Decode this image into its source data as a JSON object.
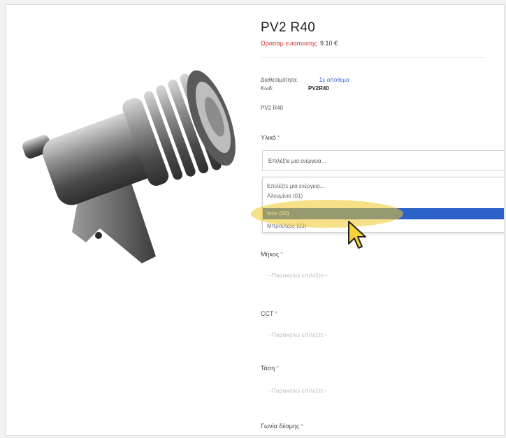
{
  "product": {
    "title": "PV2 R40",
    "price_label": "Ωρασαμ ευιαιτυιιοης",
    "price_value": "9.10 €",
    "availability_label": "Διαθεσιμότητα:",
    "availability_value": "Σε απόθεμα",
    "code_label": "Κωδ:",
    "code_value": "PV2R40",
    "sku_text": "PV2 R40"
  },
  "form": {
    "material": {
      "label": "Υλικό",
      "required_mark": "*",
      "placeholder": "Επιλέξτε μια ενέργεια...",
      "options": [
        "Επιλέξτε μια ενέργεια...",
        "Αλουμίνιο (01)",
        "Inox (03)",
        "Μπρούτζος (03)"
      ],
      "selected_index": 2
    },
    "length": {
      "label": "Μήκος",
      "required_mark": "*",
      "placeholder": "--Παρακαλώ επιλέξτε--"
    },
    "cct": {
      "label": "CCT",
      "required_mark": "*",
      "placeholder": "--Παρακαλώ επιλέξτε--"
    },
    "voltage": {
      "label": "Τάση",
      "required_mark": "*",
      "placeholder": "--Παρακαλώ επιλέξτε--"
    },
    "beam_angle": {
      "label": "Γωνία δέσμης",
      "required_mark": "*"
    }
  },
  "icons": {
    "cursor": "pointer-arrow-icon",
    "product_image": "spotlight-product-image"
  },
  "colors": {
    "highlight": "#eec828",
    "selected_option": "#2d62c9",
    "price_label": "#d0352b",
    "availability": "#3a6fd8"
  }
}
